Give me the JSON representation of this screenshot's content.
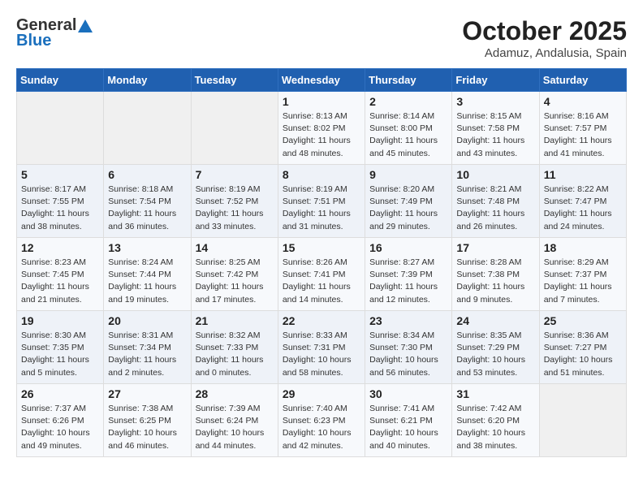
{
  "header": {
    "logo_general": "General",
    "logo_blue": "Blue",
    "month": "October 2025",
    "location": "Adamuz, Andalusia, Spain"
  },
  "days_of_week": [
    "Sunday",
    "Monday",
    "Tuesday",
    "Wednesday",
    "Thursday",
    "Friday",
    "Saturday"
  ],
  "weeks": [
    [
      {
        "date": "",
        "info": ""
      },
      {
        "date": "",
        "info": ""
      },
      {
        "date": "",
        "info": ""
      },
      {
        "date": "1",
        "info": "Sunrise: 8:13 AM\nSunset: 8:02 PM\nDaylight: 11 hours\nand 48 minutes."
      },
      {
        "date": "2",
        "info": "Sunrise: 8:14 AM\nSunset: 8:00 PM\nDaylight: 11 hours\nand 45 minutes."
      },
      {
        "date": "3",
        "info": "Sunrise: 8:15 AM\nSunset: 7:58 PM\nDaylight: 11 hours\nand 43 minutes."
      },
      {
        "date": "4",
        "info": "Sunrise: 8:16 AM\nSunset: 7:57 PM\nDaylight: 11 hours\nand 41 minutes."
      }
    ],
    [
      {
        "date": "5",
        "info": "Sunrise: 8:17 AM\nSunset: 7:55 PM\nDaylight: 11 hours\nand 38 minutes."
      },
      {
        "date": "6",
        "info": "Sunrise: 8:18 AM\nSunset: 7:54 PM\nDaylight: 11 hours\nand 36 minutes."
      },
      {
        "date": "7",
        "info": "Sunrise: 8:19 AM\nSunset: 7:52 PM\nDaylight: 11 hours\nand 33 minutes."
      },
      {
        "date": "8",
        "info": "Sunrise: 8:19 AM\nSunset: 7:51 PM\nDaylight: 11 hours\nand 31 minutes."
      },
      {
        "date": "9",
        "info": "Sunrise: 8:20 AM\nSunset: 7:49 PM\nDaylight: 11 hours\nand 29 minutes."
      },
      {
        "date": "10",
        "info": "Sunrise: 8:21 AM\nSunset: 7:48 PM\nDaylight: 11 hours\nand 26 minutes."
      },
      {
        "date": "11",
        "info": "Sunrise: 8:22 AM\nSunset: 7:47 PM\nDaylight: 11 hours\nand 24 minutes."
      }
    ],
    [
      {
        "date": "12",
        "info": "Sunrise: 8:23 AM\nSunset: 7:45 PM\nDaylight: 11 hours\nand 21 minutes."
      },
      {
        "date": "13",
        "info": "Sunrise: 8:24 AM\nSunset: 7:44 PM\nDaylight: 11 hours\nand 19 minutes."
      },
      {
        "date": "14",
        "info": "Sunrise: 8:25 AM\nSunset: 7:42 PM\nDaylight: 11 hours\nand 17 minutes."
      },
      {
        "date": "15",
        "info": "Sunrise: 8:26 AM\nSunset: 7:41 PM\nDaylight: 11 hours\nand 14 minutes."
      },
      {
        "date": "16",
        "info": "Sunrise: 8:27 AM\nSunset: 7:39 PM\nDaylight: 11 hours\nand 12 minutes."
      },
      {
        "date": "17",
        "info": "Sunrise: 8:28 AM\nSunset: 7:38 PM\nDaylight: 11 hours\nand 9 minutes."
      },
      {
        "date": "18",
        "info": "Sunrise: 8:29 AM\nSunset: 7:37 PM\nDaylight: 11 hours\nand 7 minutes."
      }
    ],
    [
      {
        "date": "19",
        "info": "Sunrise: 8:30 AM\nSunset: 7:35 PM\nDaylight: 11 hours\nand 5 minutes."
      },
      {
        "date": "20",
        "info": "Sunrise: 8:31 AM\nSunset: 7:34 PM\nDaylight: 11 hours\nand 2 minutes."
      },
      {
        "date": "21",
        "info": "Sunrise: 8:32 AM\nSunset: 7:33 PM\nDaylight: 11 hours\nand 0 minutes."
      },
      {
        "date": "22",
        "info": "Sunrise: 8:33 AM\nSunset: 7:31 PM\nDaylight: 10 hours\nand 58 minutes."
      },
      {
        "date": "23",
        "info": "Sunrise: 8:34 AM\nSunset: 7:30 PM\nDaylight: 10 hours\nand 56 minutes."
      },
      {
        "date": "24",
        "info": "Sunrise: 8:35 AM\nSunset: 7:29 PM\nDaylight: 10 hours\nand 53 minutes."
      },
      {
        "date": "25",
        "info": "Sunrise: 8:36 AM\nSunset: 7:27 PM\nDaylight: 10 hours\nand 51 minutes."
      }
    ],
    [
      {
        "date": "26",
        "info": "Sunrise: 7:37 AM\nSunset: 6:26 PM\nDaylight: 10 hours\nand 49 minutes."
      },
      {
        "date": "27",
        "info": "Sunrise: 7:38 AM\nSunset: 6:25 PM\nDaylight: 10 hours\nand 46 minutes."
      },
      {
        "date": "28",
        "info": "Sunrise: 7:39 AM\nSunset: 6:24 PM\nDaylight: 10 hours\nand 44 minutes."
      },
      {
        "date": "29",
        "info": "Sunrise: 7:40 AM\nSunset: 6:23 PM\nDaylight: 10 hours\nand 42 minutes."
      },
      {
        "date": "30",
        "info": "Sunrise: 7:41 AM\nSunset: 6:21 PM\nDaylight: 10 hours\nand 40 minutes."
      },
      {
        "date": "31",
        "info": "Sunrise: 7:42 AM\nSunset: 6:20 PM\nDaylight: 10 hours\nand 38 minutes."
      },
      {
        "date": "",
        "info": ""
      }
    ]
  ]
}
